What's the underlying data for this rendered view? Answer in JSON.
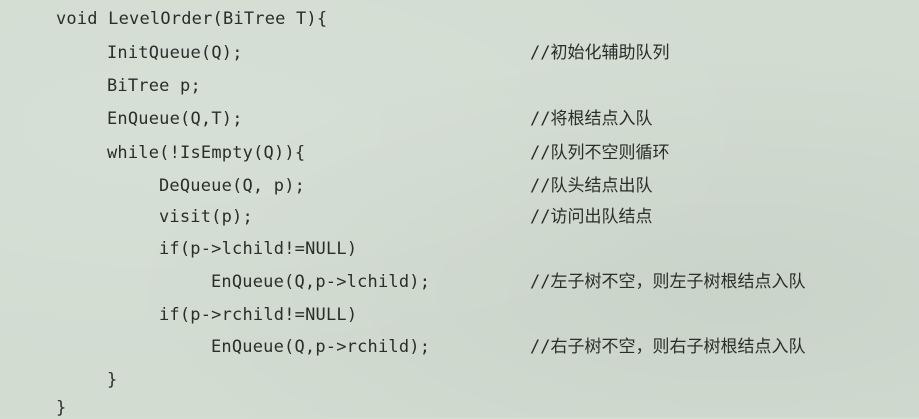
{
  "code": {
    "lines": [
      {
        "code": "void LevelOrder(BiTree T){",
        "comment": ""
      },
      {
        "code": "InitQueue(Q);",
        "comment": "//初始化辅助队列"
      },
      {
        "code": "BiTree p;",
        "comment": ""
      },
      {
        "code": "EnQueue(Q,T);",
        "comment": "//将根结点入队"
      },
      {
        "code": "while(!IsEmpty(Q)){",
        "comment": "//队列不空则循环"
      },
      {
        "code": "DeQueue(Q, p);",
        "comment": "//队头结点出队"
      },
      {
        "code": "visit(p);",
        "comment": "//访问出队结点"
      },
      {
        "code": "if(p->lchild!=NULL)",
        "comment": ""
      },
      {
        "code": "EnQueue(Q,p->lchild);",
        "comment": "//左子树不空，则左子树根结点入队"
      },
      {
        "code": "if(p->rchild!=NULL)",
        "comment": ""
      },
      {
        "code": "EnQueue(Q,p->rchild);",
        "comment": "//右子树不空，则右子树根结点入队"
      },
      {
        "code": "}",
        "comment": ""
      },
      {
        "code": "}",
        "comment": ""
      }
    ]
  }
}
